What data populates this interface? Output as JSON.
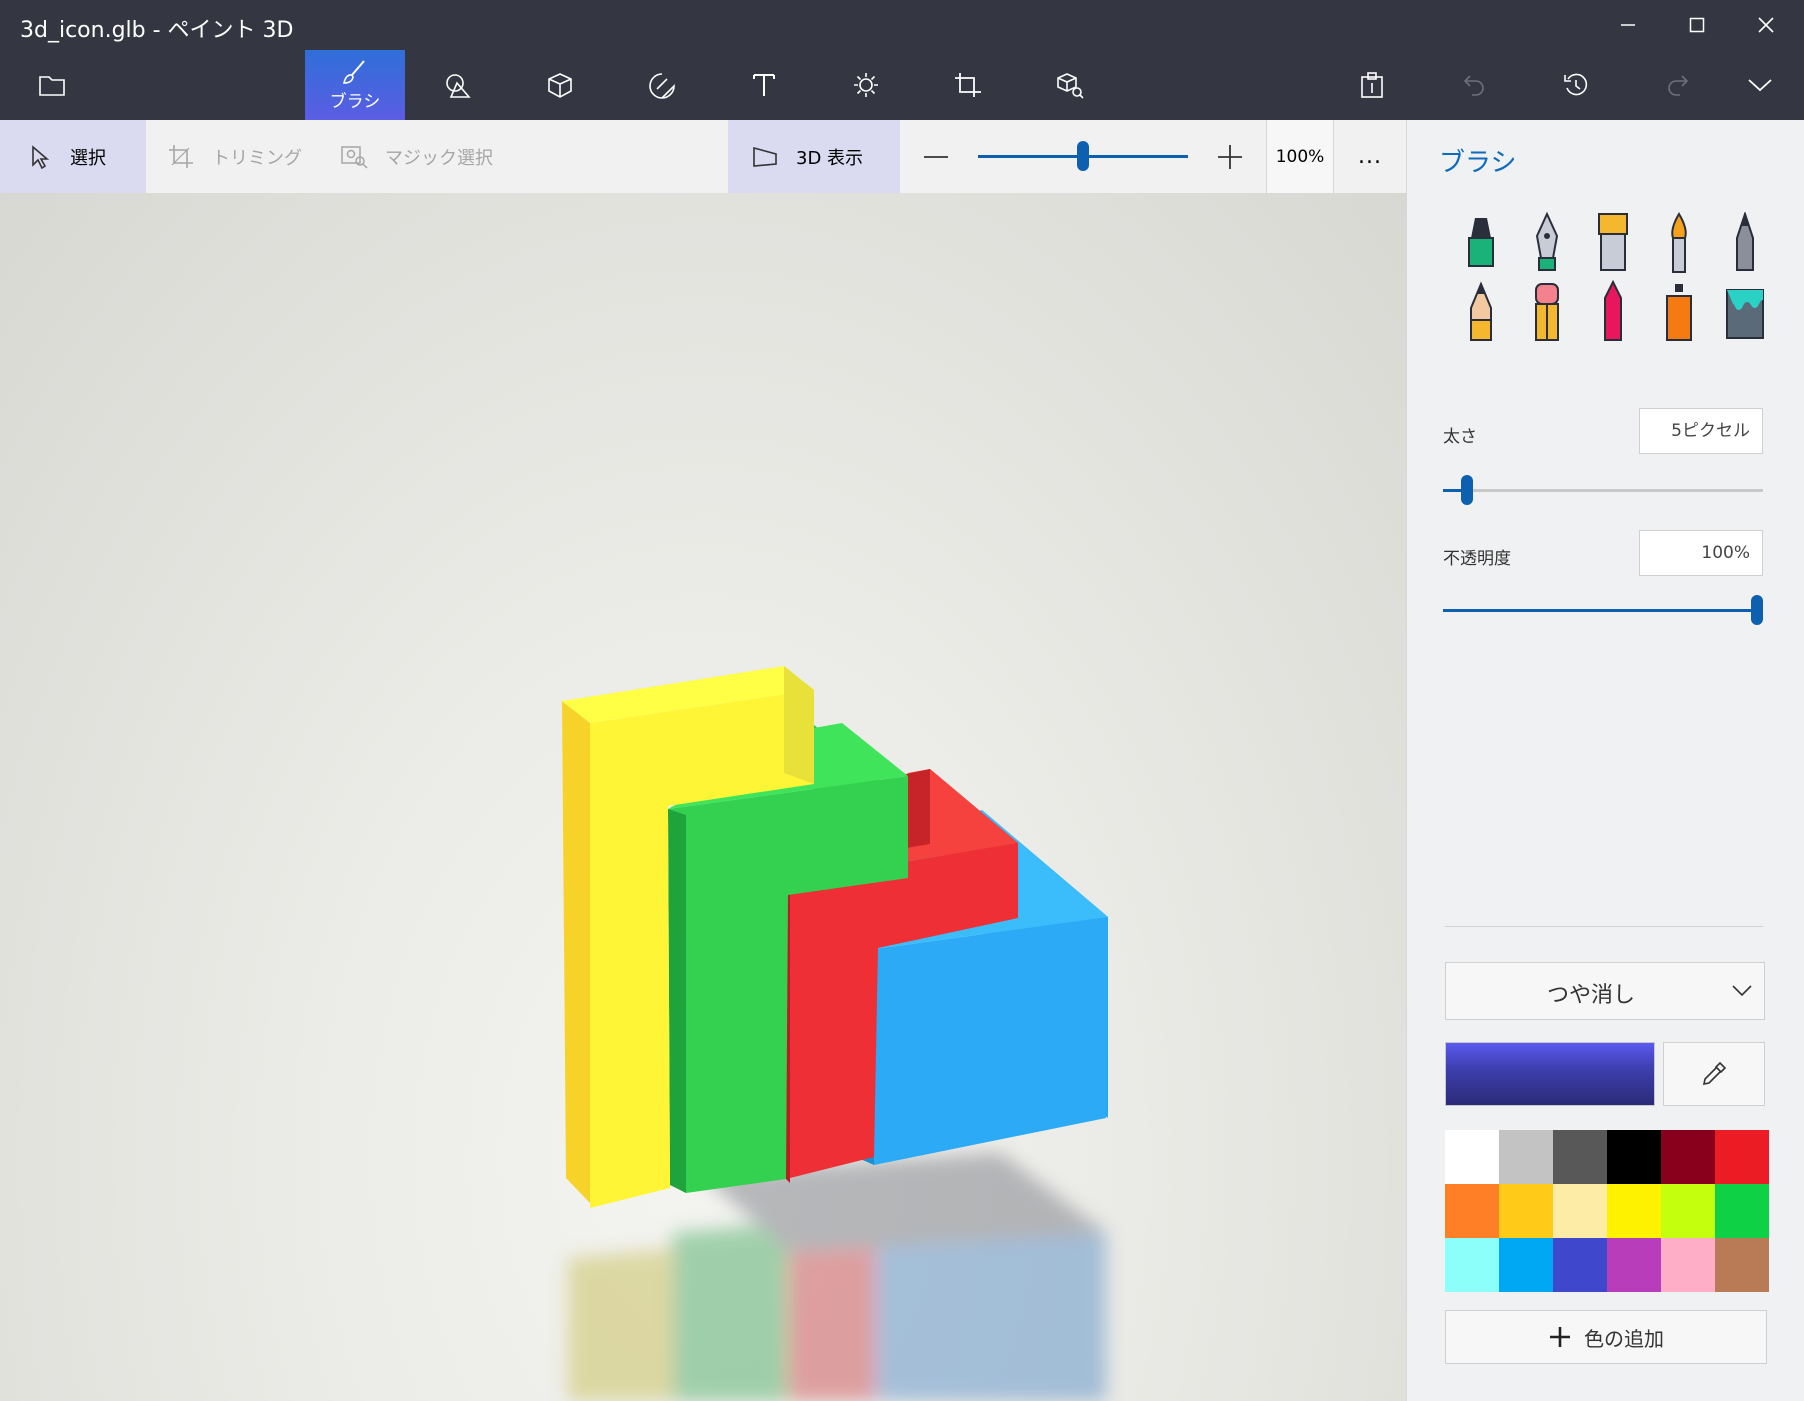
{
  "window": {
    "title": "3d_icon.glb - ペイント 3D"
  },
  "toolbar": {
    "brushes_label": "ブラシ"
  },
  "subbar": {
    "select_label": "選択",
    "crop_label": "トリミング",
    "magic_select_label": "マジック選択",
    "view3d_label": "3D 表示",
    "zoom_value": "100%",
    "zoom_level": 0.5,
    "more_label": "..."
  },
  "panel": {
    "title": "ブラシ",
    "thickness_label": "太さ",
    "thickness_value": "5ピクセル",
    "thickness_level": 0.06,
    "opacity_label": "不透明度",
    "opacity_value": "100%",
    "opacity_level": 1.0,
    "finish_value": "つや消し",
    "current_color": "#3f3fb0",
    "add_color_label": "色の追加",
    "brushes": [
      {
        "name": "marker-brush-icon"
      },
      {
        "name": "calligraphy-pen-icon"
      },
      {
        "name": "oil-brush-icon"
      },
      {
        "name": "watercolor-brush-icon"
      },
      {
        "name": "pixel-pen-icon"
      },
      {
        "name": "pencil-icon"
      },
      {
        "name": "eraser-icon"
      },
      {
        "name": "crayon-icon"
      },
      {
        "name": "spray-can-icon"
      },
      {
        "name": "fill-bucket-icon"
      }
    ],
    "palette": [
      "#ffffff",
      "#c3c3c3",
      "#585858",
      "#000000",
      "#88001b",
      "#ec1c24",
      "#ff7f27",
      "#ffca18",
      "#fdeca6",
      "#fff200",
      "#c4ff0e",
      "#0ed145",
      "#8cfffb",
      "#00a8f3",
      "#3f48cc",
      "#b83dba",
      "#ffaec8",
      "#b97a56"
    ]
  }
}
